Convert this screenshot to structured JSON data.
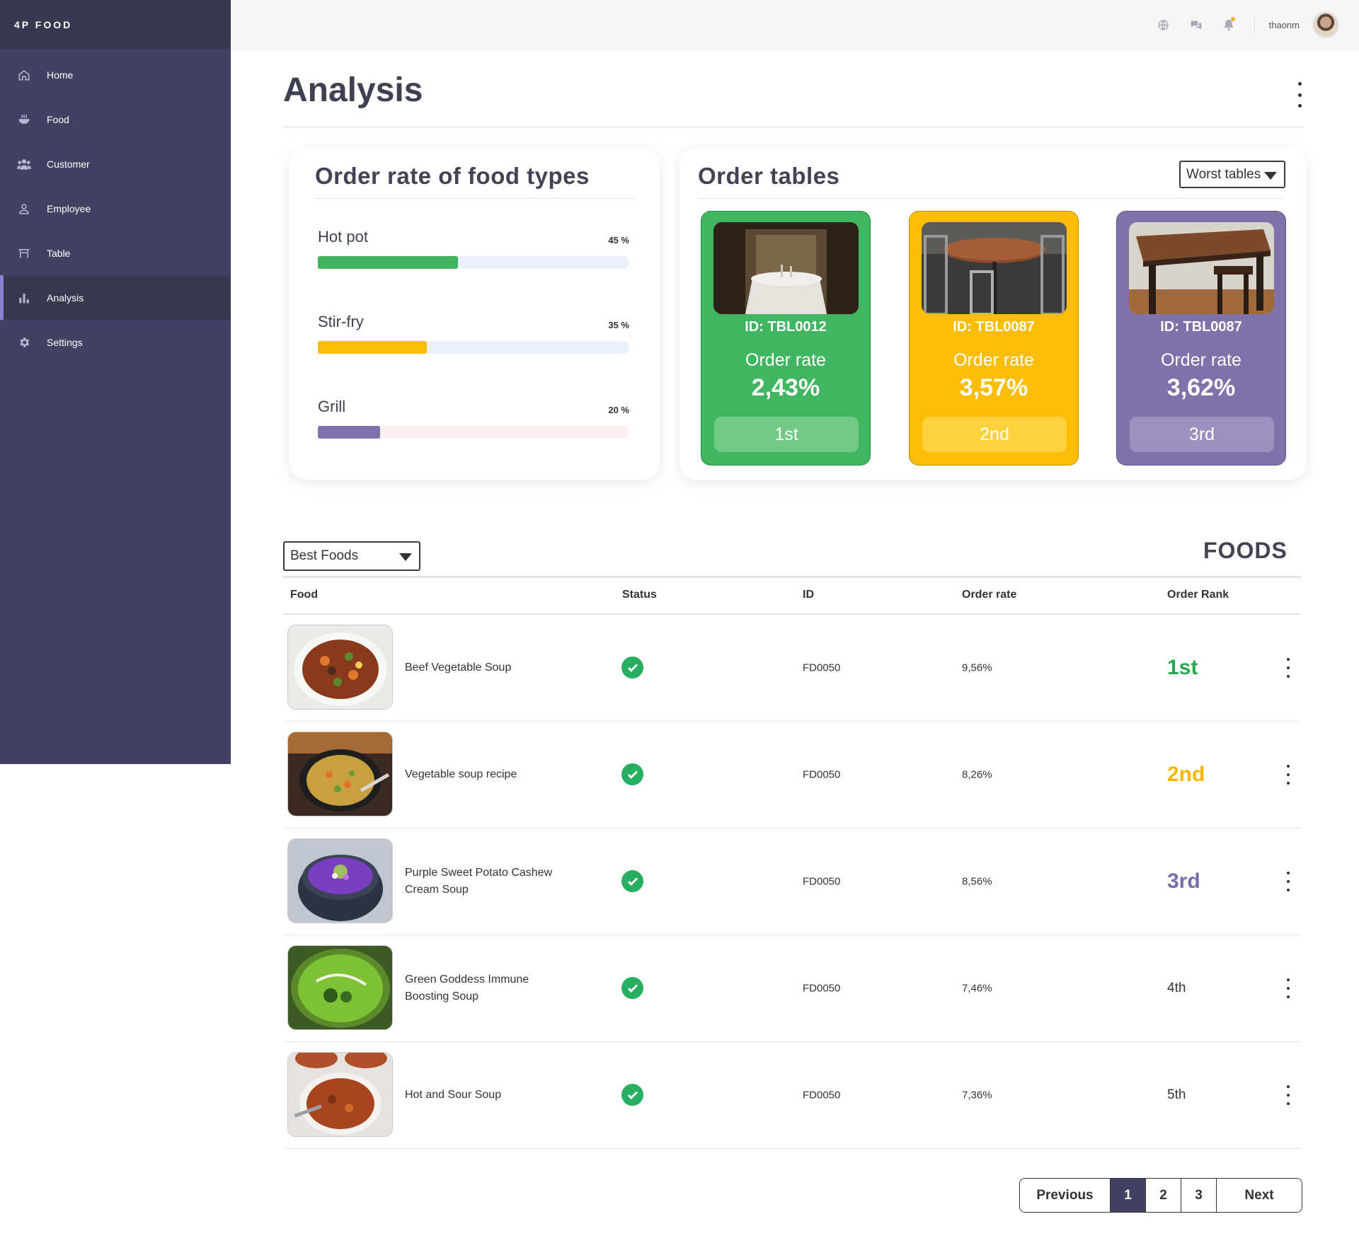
{
  "sidebar": {
    "brand": "4P FOOD",
    "items": [
      {
        "label": "Home",
        "icon": "home-icon"
      },
      {
        "label": "Food",
        "icon": "bowl-icon"
      },
      {
        "label": "Customer",
        "icon": "users-icon"
      },
      {
        "label": "Employee",
        "icon": "user-icon"
      },
      {
        "label": "Table",
        "icon": "table-icon"
      },
      {
        "label": "Analysis",
        "icon": "bar-chart-icon",
        "active": true
      },
      {
        "label": "Settings",
        "icon": "gear-icon"
      }
    ]
  },
  "topbar": {
    "icons": [
      "globe-icon",
      "chat-icon",
      "bell-icon"
    ],
    "username": "thaonm"
  },
  "page": {
    "title": "Analysis"
  },
  "food_types": {
    "title": "Order rate of food types",
    "items": [
      {
        "label": "Hot pot",
        "percent_text": "45 %",
        "value": 45,
        "color": "#3fb55d",
        "track": "#eaf0fb"
      },
      {
        "label": "Stir-fry",
        "percent_text": "35 %",
        "value": 35,
        "color": "#fbbd05",
        "track": "#eaf0fb"
      },
      {
        "label": "Grill",
        "percent_text": "20 %",
        "value": 20,
        "color": "#8070ac",
        "track": "#fcefef"
      }
    ]
  },
  "order_tables": {
    "title": "Order tables",
    "select_value": "Worst tables",
    "cards": [
      {
        "id": "ID: TBL0012",
        "rate_label": "Order rate",
        "rate": "2,43%",
        "rank": "1st",
        "color": "#41b661",
        "rank_bg": "#71c986"
      },
      {
        "id": "ID: TBL0087",
        "rate_label": "Order rate",
        "rate": "3,57%",
        "rank": "2nd",
        "color": "#fcbd05",
        "rank_bg": "#fdd23e"
      },
      {
        "id": "ID: TBL0087",
        "rate_label": "Order rate",
        "rate": "3,62%",
        "rank": "3rd",
        "color": "#8071ab",
        "rank_bg": "#9c90c0"
      }
    ]
  },
  "foods": {
    "select_value": "Best Foods",
    "title": "FOODS",
    "columns": [
      "Food",
      "Status",
      "ID",
      "Order rate",
      "Order Rank"
    ],
    "rows": [
      {
        "name": "Beef Vegetable Soup",
        "id": "FD0050",
        "rate": "9,56%",
        "rank": "1st",
        "rank_color": "#2aa651",
        "rank_bold": true
      },
      {
        "name": "Vegetable soup recipe",
        "id": "FD0050",
        "rate": "8,26%",
        "rank": "2nd",
        "rank_color": "#f7b500",
        "rank_bold": true
      },
      {
        "name": "Purple Sweet Potato Cashew Cream Soup",
        "id": "FD0050",
        "rate": "8,56%",
        "rank": "3rd",
        "rank_color": "#7a6ca9",
        "rank_bold": true
      },
      {
        "name": "Green Goddess Immune Boosting Soup",
        "id": "FD0050",
        "rate": "7,46%",
        "rank": "4th",
        "rank_color": "#333333",
        "rank_bold": false
      },
      {
        "name": "Hot and Sour Soup",
        "id": "FD0050",
        "rate": "7,36%",
        "rank": "5th",
        "rank_color": "#333333",
        "rank_bold": false
      }
    ]
  },
  "pagination": {
    "previous": "Previous",
    "pages": [
      "1",
      "2",
      "3"
    ],
    "current": "1",
    "next": "Next"
  }
}
